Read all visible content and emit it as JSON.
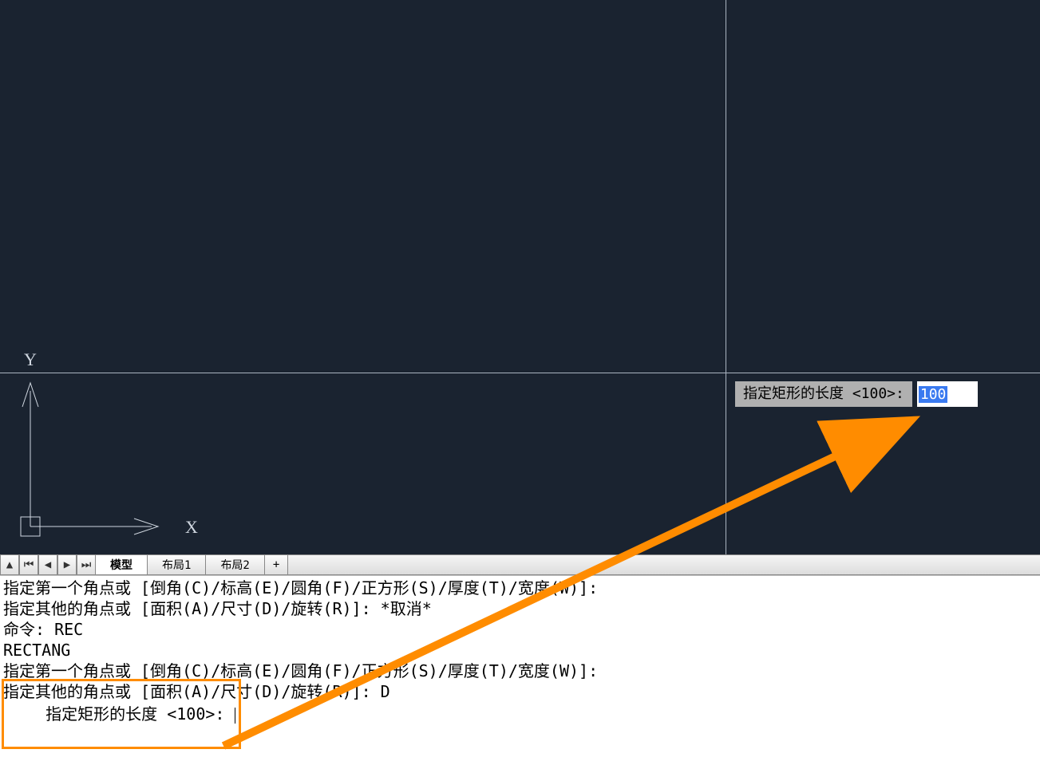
{
  "canvas": {
    "prompt_label": "指定矩形的长度 <100>:",
    "prompt_value": "100",
    "ucs": {
      "y_label": "Y",
      "x_label": "X"
    }
  },
  "tabs": {
    "model": "模型",
    "layout1": "布局1",
    "layout2": "布局2",
    "plus": "+"
  },
  "cmd": {
    "l1": "指定第一个角点或 [倒角(C)/标高(E)/圆角(F)/正方形(S)/厚度(T)/宽度(W)]:",
    "l2": "指定其他的角点或 [面积(A)/尺寸(D)/旋转(R)]: *取消*",
    "l3": "命令: REC",
    "l4": "RECTANG",
    "l5": "指定第一个角点或 [倒角(C)/标高(E)/圆角(F)/正方形(S)/厚度(T)/宽度(W)]:",
    "l6": "指定其他的角点或 [面积(A)/尺寸(D)/旋转(R)]: D",
    "current": "指定矩形的长度 <100>: "
  },
  "annotation": {
    "arrow_color": "#ff8c00"
  }
}
